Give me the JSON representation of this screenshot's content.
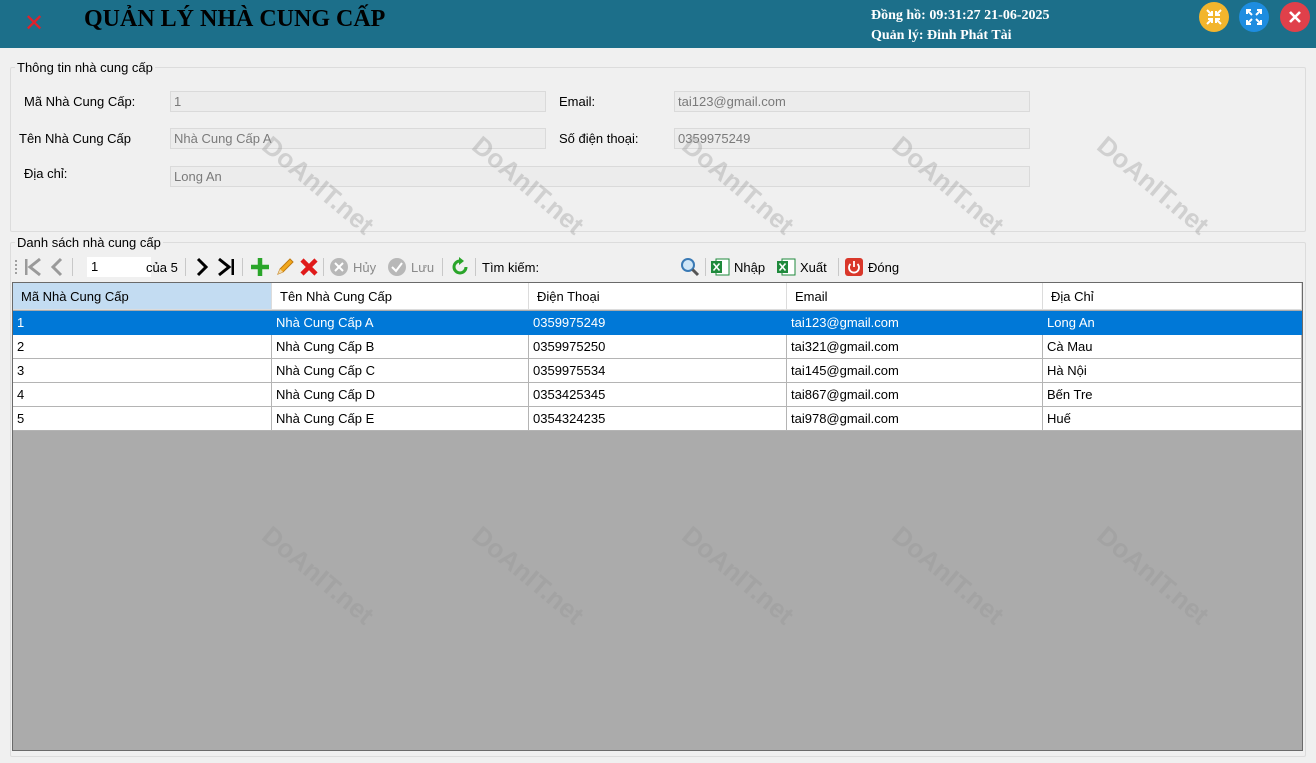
{
  "header": {
    "title": "QUẢN LÝ NHÀ CUNG CẤP",
    "clock": "Đồng hồ: 09:31:27 21-06-2025",
    "manager": "Quản lý: Đinh Phát Tài",
    "colors": {
      "bar": "#1c6f8a",
      "minimize": "#f2b52d",
      "maximize": "#1e8de0",
      "close": "#e0404a"
    }
  },
  "info": {
    "group_title": "Thông tin nhà cung cấp",
    "id_label": "Mã Nhà Cung Cấp:",
    "id_value": "1",
    "name_label": "Tên Nhà Cung Cấp",
    "name_value": "Nhà Cung Cấp A",
    "address_label": "Địa chỉ:",
    "address_value": "Long An",
    "email_label": "Email:",
    "email_value": "tai123@gmail.com",
    "phone_label": "Số điện thoại:",
    "phone_value": "0359975249"
  },
  "list": {
    "group_title": "Danh sách nhà cung cấp"
  },
  "toolbar": {
    "position": "1",
    "of_count": "của 5",
    "cancel_label": "Hủy",
    "save_label": "Lưu",
    "search_label": "Tìm kiếm:",
    "import_label": "Nhập",
    "export_label": "Xuất",
    "close_label": "Đóng"
  },
  "grid": {
    "columns": [
      "Mã Nhà Cung Cấp",
      "Tên Nhà Cung Cấp",
      "Điện Thoại",
      "Email",
      "Địa Chỉ"
    ],
    "rows": [
      [
        "1",
        "Nhà Cung Cấp A",
        "0359975249",
        "tai123@gmail.com",
        "Long An"
      ],
      [
        "2",
        "Nhà Cung Cấp B",
        "0359975250",
        "tai321@gmail.com",
        "Cà Mau"
      ],
      [
        "3",
        "Nhà Cung Cấp C",
        "0359975534",
        "tai145@gmail.com",
        "Hà Nội"
      ],
      [
        "4",
        "Nhà Cung Cấp D",
        "0353425345",
        "tai867@gmail.com",
        "Bến Tre"
      ],
      [
        "5",
        "Nhà Cung Cấp E",
        "0354324235",
        "tai978@gmail.com",
        "Huế"
      ]
    ],
    "selected_row": 1
  },
  "watermark": "DoAnIT.net"
}
